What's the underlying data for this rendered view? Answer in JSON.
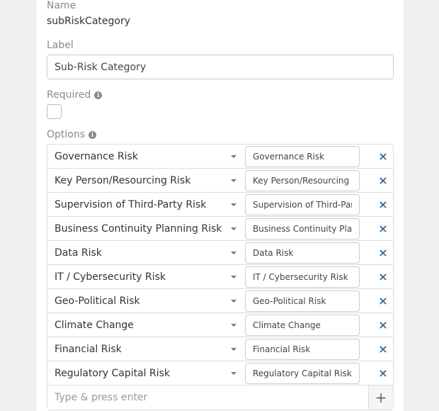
{
  "name": {
    "label": "Name",
    "value": "subRiskCategory"
  },
  "label_field": {
    "label": "Label",
    "value": "Sub-Risk Category"
  },
  "required": {
    "label": "Required",
    "checked": false,
    "info_icon": "info-icon"
  },
  "options": {
    "label": "Options",
    "info_icon": "info-icon",
    "items": [
      {
        "label": "Governance Risk",
        "value": "Governance Risk"
      },
      {
        "label": "Key Person/Resourcing Risk",
        "value": "Key Person/Resourcing Ri"
      },
      {
        "label": "Supervision of Third-Party Risk",
        "value": "Supervision of Third-Party"
      },
      {
        "label": "Business Continuity Planning Risk",
        "value": "Business Continuity Plann"
      },
      {
        "label": "Data Risk",
        "value": "Data Risk"
      },
      {
        "label": "IT / Cybersecurity Risk",
        "value": "IT / Cybersecurity Risk"
      },
      {
        "label": "Geo-Political Risk",
        "value": "Geo-Political Risk"
      },
      {
        "label": "Climate Change",
        "value": "Climate Change"
      },
      {
        "label": "Financial Risk",
        "value": "Financial Risk"
      },
      {
        "label": "Regulatory Capital Risk",
        "value": "Regulatory Capital Risk"
      }
    ],
    "remove_icon": "×",
    "add_placeholder": "Type & press enter",
    "add_icon": "+"
  },
  "colors": {
    "remove": "#3f6b9c",
    "border": "#dcdcdc",
    "muted_label": "#8a8a8a"
  }
}
